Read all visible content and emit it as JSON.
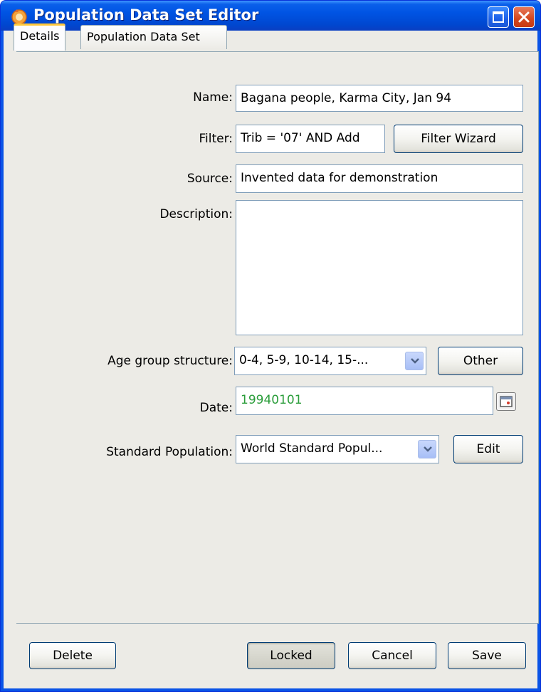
{
  "window": {
    "title": "Population Data Set Editor"
  },
  "tabs": [
    {
      "label": "Details"
    },
    {
      "label": "Population Data Set"
    }
  ],
  "form": {
    "name": {
      "label": "Name:",
      "value": "Bagana people, Karma City, Jan 94"
    },
    "filter": {
      "label": "Filter:",
      "value": "Trib = '07'  AND Add",
      "button": "Filter Wizard"
    },
    "source": {
      "label": "Source:",
      "value": "Invented data for demonstration"
    },
    "description": {
      "label": "Description:",
      "value": ""
    },
    "age_group": {
      "label": "Age group structure:",
      "value": "0-4, 5-9, 10-14, 15-...",
      "button": "Other"
    },
    "date": {
      "label": "Date:",
      "value": "19940101"
    },
    "standard_population": {
      "label": "Standard Population:",
      "value": "World Standard Popul...",
      "button": "Edit"
    }
  },
  "footer": {
    "delete": "Delete",
    "locked": "Locked",
    "cancel": "Cancel",
    "save": "Save"
  },
  "colors": {
    "titlebar": "#0054e3",
    "client_bg": "#ecebe6",
    "date_text": "#2a9d3a"
  }
}
